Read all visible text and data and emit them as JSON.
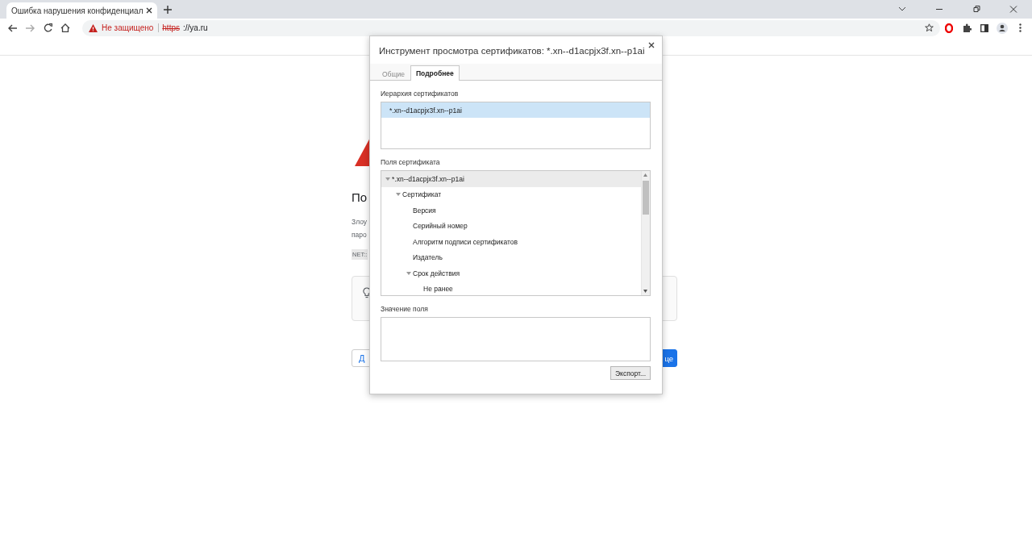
{
  "browser": {
    "tabs": [
      {
        "title": "Ошибка нарушения конфиденциал",
        "selected": true
      }
    ],
    "security_label": "Не защищено",
    "url_scheme": "https",
    "url_rest": "://ya.ru"
  },
  "page": {
    "heading": "По",
    "lines": [
      "Злоу",
      "паро"
    ],
    "error_code": "NET::",
    "buttons": [
      {
        "label": "Д",
        "kind": "secondary"
      },
      {
        "label": "це",
        "kind": "primary"
      }
    ]
  },
  "dialog": {
    "title": "Инструмент просмотра сертификатов: *.xn--d1acpjx3f.xn--p1ai",
    "tabs": [
      {
        "label": "Общие",
        "selected": false
      },
      {
        "label": "Подробнее",
        "selected": true
      }
    ],
    "hierarchy_label": "Иерархия сертификатов",
    "hierarchy": [
      {
        "label": "*.xn--d1acpjx3f.xn--p1ai",
        "selected": true
      }
    ],
    "fields_label": "Поля сертификата",
    "fields": [
      {
        "label": "*.xn--d1acpjx3f.xn--p1ai",
        "selected": true,
        "expanded": true,
        "children": [
          {
            "label": "Сертификат",
            "selected": false,
            "expanded": true,
            "children": [
              {
                "label": "Версия",
                "selected": false
              },
              {
                "label": "Серийный номер",
                "selected": false
              },
              {
                "label": "Алгоритм подписи сертификатов",
                "selected": false
              },
              {
                "label": "Издатель",
                "selected": false
              },
              {
                "label": "Срок действия",
                "selected": false,
                "expanded": true,
                "children": [
                  {
                    "label": "Не ранее",
                    "selected": false
                  }
                ]
              }
            ]
          }
        ]
      }
    ],
    "value_label": "Значение поля",
    "export_button": "Экспорт..."
  }
}
